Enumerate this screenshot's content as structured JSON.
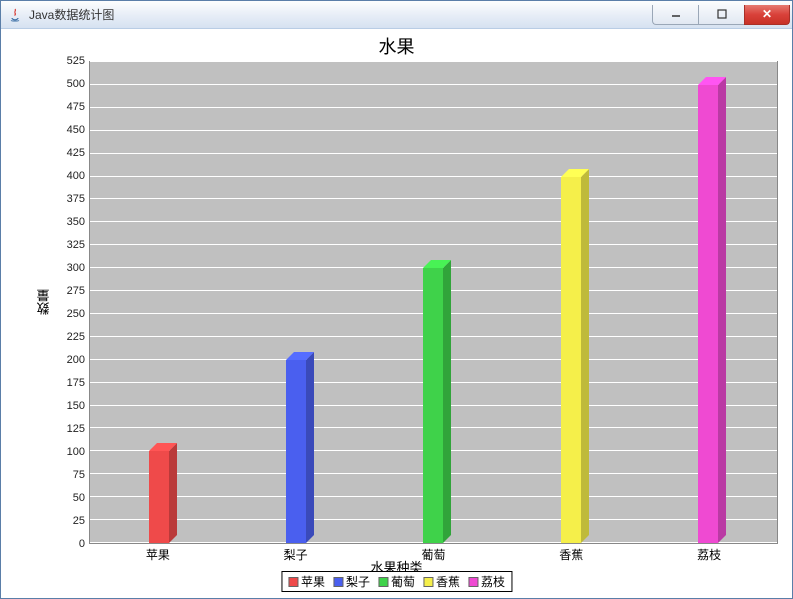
{
  "window": {
    "title": "Java数据统计图",
    "icon": "java-icon"
  },
  "chart_data": {
    "type": "bar",
    "title": "水果",
    "xlabel": "水果种类",
    "ylabel": "数量",
    "ylim": [
      0,
      525
    ],
    "ytick_interval": 25,
    "categories": [
      "苹果",
      "梨子",
      "葡萄",
      "香蕉",
      "荔枝"
    ],
    "values": [
      100,
      200,
      300,
      400,
      500
    ],
    "colors": [
      "#ef4a4a",
      "#4a5fef",
      "#3fd24a",
      "#f5ef4a",
      "#ef4ad2"
    ],
    "legend": [
      "苹果",
      "梨子",
      "葡萄",
      "香蕉",
      "荔枝"
    ]
  }
}
